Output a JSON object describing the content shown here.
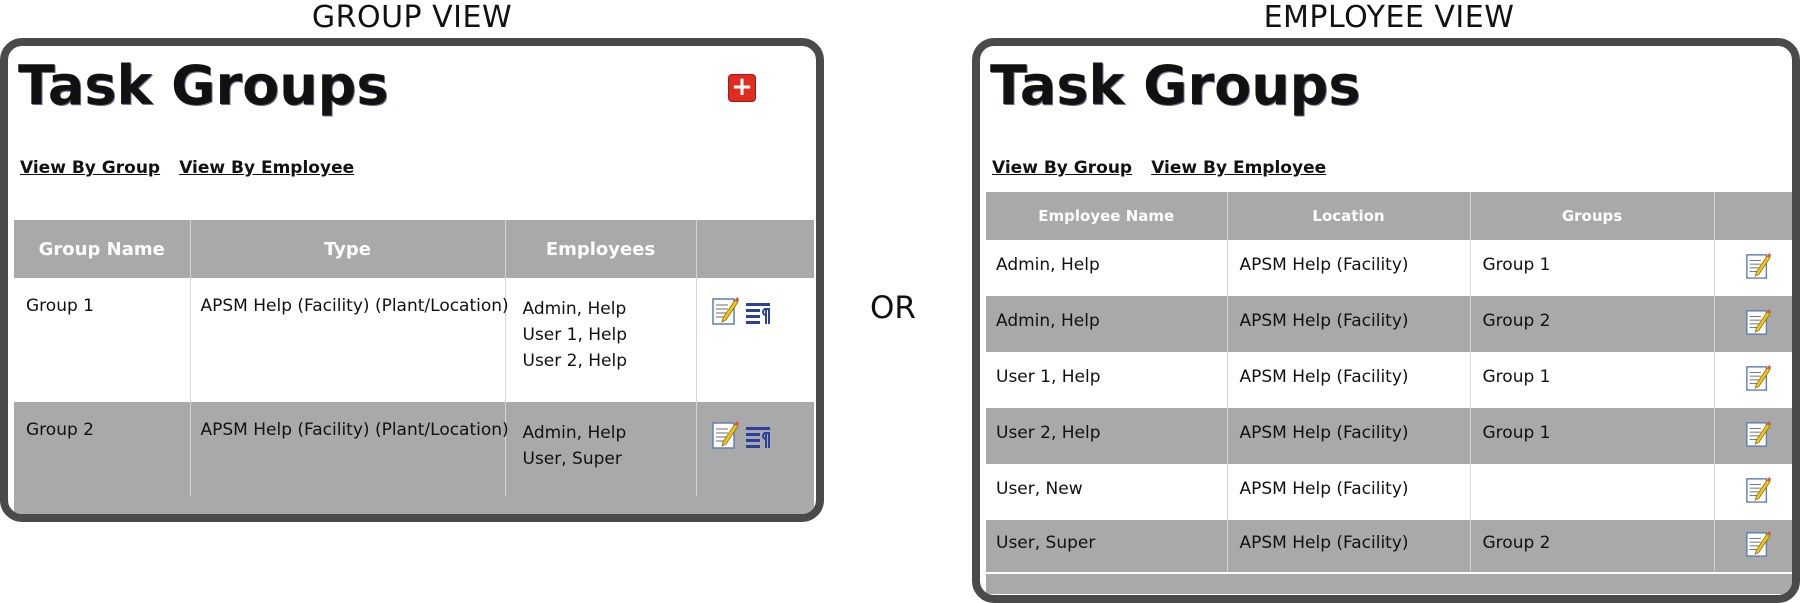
{
  "captions": {
    "group_view": "GROUP VIEW",
    "or": "OR",
    "employee_view": "EMPLOYEE VIEW"
  },
  "group_panel": {
    "title": "Task Groups",
    "add_button": "+",
    "links": [
      "View By Group",
      "View By Employee"
    ],
    "columns": [
      "Group Name",
      "Type",
      "Employees",
      ""
    ],
    "rows": [
      {
        "name": "Group 1",
        "type": "APSM Help (Facility) (Plant/Location)",
        "employees": [
          "Admin, Help",
          "User 1, Help",
          "User 2, Help"
        ]
      },
      {
        "name": "Group 2",
        "type": "APSM Help (Facility) (Plant/Location)",
        "employees": [
          "Admin, Help",
          "User, Super"
        ]
      }
    ]
  },
  "employee_panel": {
    "title": "Task Groups",
    "links": [
      "View By Group",
      "View By Employee"
    ],
    "columns": [
      "Employee Name",
      "Location",
      "Groups",
      ""
    ],
    "rows": [
      {
        "name": "Admin, Help",
        "location": "APSM Help (Facility)",
        "group": "Group 1"
      },
      {
        "name": "Admin, Help",
        "location": "APSM Help (Facility)",
        "group": "Group 2"
      },
      {
        "name": "User 1, Help",
        "location": "APSM Help (Facility)",
        "group": "Group 1"
      },
      {
        "name": "User 2, Help",
        "location": "APSM Help (Facility)",
        "group": "Group 1"
      },
      {
        "name": "User, New",
        "location": "APSM Help (Facility)",
        "group": ""
      },
      {
        "name": "User, Super",
        "location": "APSM Help (Facility)",
        "group": "Group 2"
      }
    ]
  },
  "icons": {
    "edit": "edit-note-icon",
    "list": "list-paragraph-icon",
    "add": "plus-icon"
  },
  "colors": {
    "header_bg": "#a9a9a9",
    "panel_border": "#4a4a4a",
    "add_button": "#e02b20",
    "list_icon": "#2b3f9e"
  }
}
